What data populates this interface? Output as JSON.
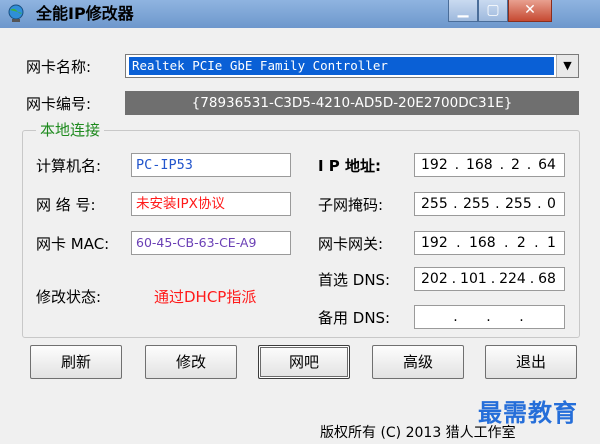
{
  "window": {
    "title": "全能IP修改器"
  },
  "card_name": {
    "label": "网卡名称:",
    "value": "Realtek PCIe GbE Family Controller"
  },
  "card_id": {
    "label": "网卡编号:",
    "value": "{78936531-C3D5-4210-AD5D-20E2700DC31E}"
  },
  "local_group": {
    "title": "本地连接"
  },
  "computer_name": {
    "label": "计算机名:",
    "value": "PC-IP53"
  },
  "network_no": {
    "label": "网 络 号:",
    "value": "未安装IPX协议"
  },
  "mac": {
    "label": "网卡 MAC:",
    "value": "60-45-CB-63-CE-A9"
  },
  "status": {
    "label": "修改状态:",
    "value": "通过DHCP指派"
  },
  "ip": {
    "label": "I P 地址:",
    "octets": [
      "192",
      "168",
      "2",
      "64"
    ]
  },
  "subnet": {
    "label": "子网掩码:",
    "octets": [
      "255",
      "255",
      "255",
      "0"
    ]
  },
  "gateway": {
    "label": "网卡网关:",
    "octets": [
      "192",
      "168",
      "2",
      "1"
    ]
  },
  "dns1": {
    "label": "首选 DNS:",
    "octets": [
      "202",
      "101",
      "224",
      "68"
    ]
  },
  "dns2": {
    "label": "备用 DNS:",
    "octets": [
      "",
      "",
      "",
      ""
    ]
  },
  "buttons": {
    "refresh": "刷新",
    "modify": "修改",
    "wangba": "网吧",
    "advanced": "高级",
    "exit": "退出"
  },
  "footer": {
    "copyright": "版权所有 (C) 2013 猎人工作室",
    "watermark": "最需教育"
  },
  "colors": {
    "selection": "#0a60d6",
    "group_title": "#1e8a1e",
    "error_text": "#ff1a1a",
    "field_text_blue": "#2255cc",
    "mac_text": "#6a3fb5"
  }
}
